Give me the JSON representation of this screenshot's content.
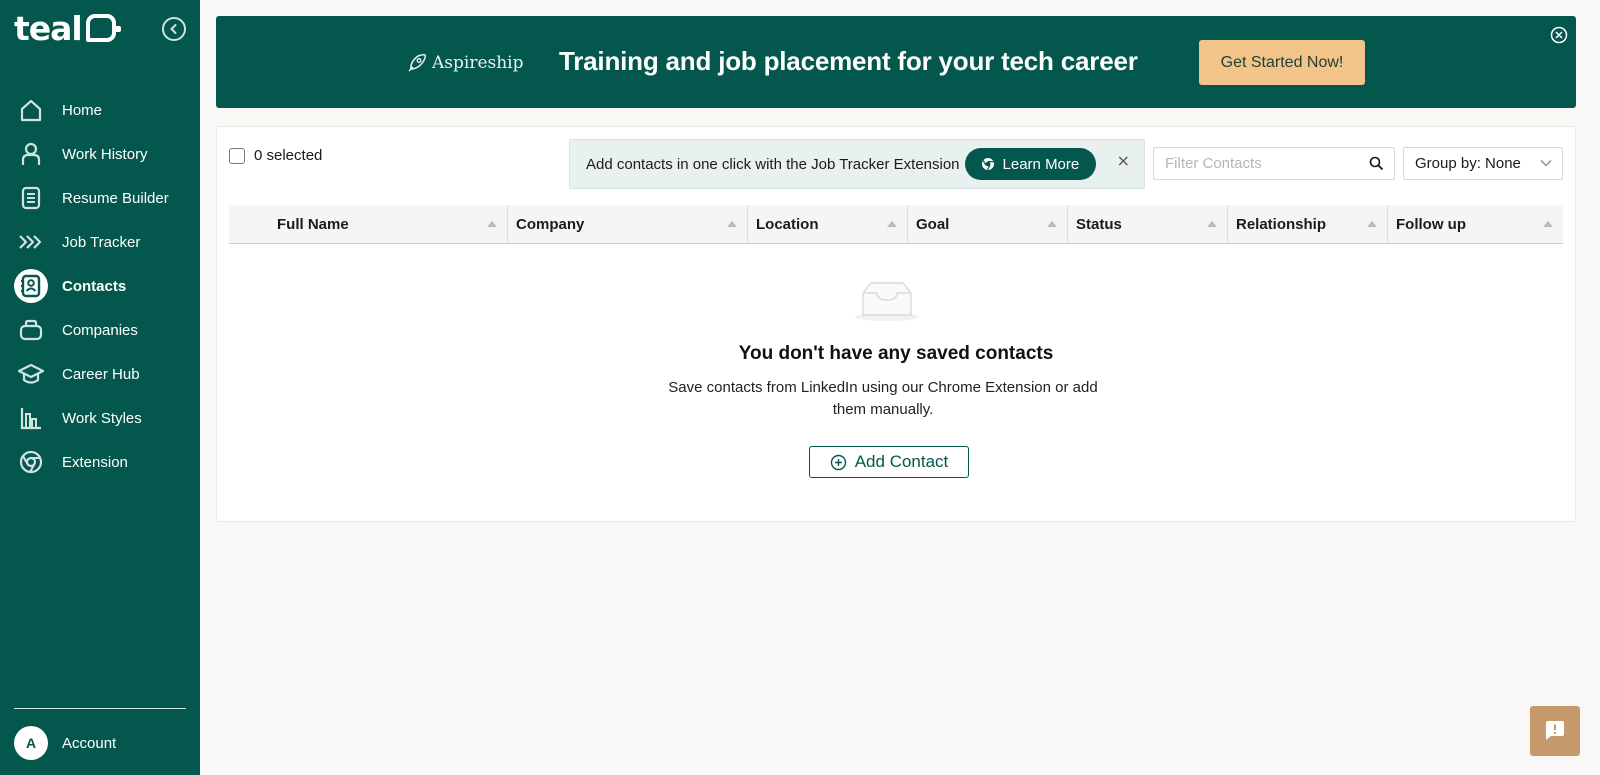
{
  "sidebar": {
    "logo_text": "teal",
    "items": [
      {
        "label": "Home",
        "icon": "home-icon"
      },
      {
        "label": "Work History",
        "icon": "person-icon"
      },
      {
        "label": "Resume Builder",
        "icon": "document-icon"
      },
      {
        "label": "Job Tracker",
        "icon": "chevrons-right-icon"
      },
      {
        "label": "Contacts",
        "icon": "contact-book-icon",
        "active": true
      },
      {
        "label": "Companies",
        "icon": "briefcase-icon"
      },
      {
        "label": "Career Hub",
        "icon": "graduation-cap-icon"
      },
      {
        "label": "Work Styles",
        "icon": "bar-chart-icon"
      },
      {
        "label": "Extension",
        "icon": "chrome-icon"
      }
    ],
    "account": {
      "avatar_letter": "A",
      "label": "Account"
    }
  },
  "banner": {
    "brand": "Aspireship",
    "headline": "Training and job placement for your tech career",
    "cta_label": "Get Started Now!"
  },
  "toolbar": {
    "selected_label": "0 selected",
    "promo_text": "Add contacts in one click with the Job Tracker Extension",
    "learn_more_label": "Learn More",
    "promo_close": "×",
    "filter_placeholder": "Filter Contacts",
    "group_by_label": "Group by: None"
  },
  "table": {
    "columns": [
      "Full Name",
      "Company",
      "Location",
      "Goal",
      "Status",
      "Relationship",
      "Follow up"
    ]
  },
  "empty_state": {
    "title": "You don't have any saved contacts",
    "description": "Save contacts from LinkedIn using our Chrome Extension or add them manually.",
    "add_button_label": "Add Contact"
  },
  "colors": {
    "brand_green": "#04574c",
    "cta_orange": "#f2c48a",
    "feedback_tan": "#c79a6e"
  }
}
